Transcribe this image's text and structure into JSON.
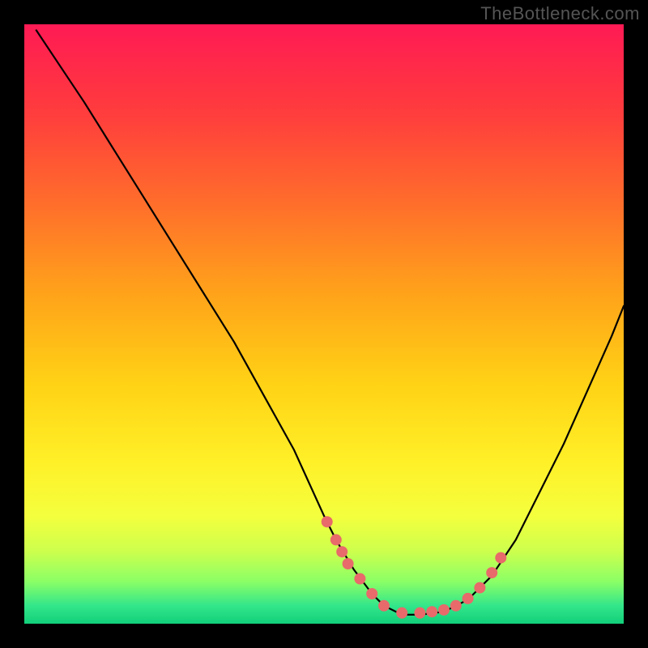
{
  "watermark": "TheBottleneck.com",
  "chart_data": {
    "type": "line",
    "title": "",
    "xlabel": "",
    "ylabel": "",
    "xlim": [
      0,
      100
    ],
    "ylim": [
      0,
      100
    ],
    "grid": false,
    "legend": false,
    "series": [
      {
        "name": "curve",
        "x": [
          2,
          6,
          10,
          15,
          20,
          25,
          30,
          35,
          40,
          45,
          50,
          52,
          55,
          58,
          60,
          63,
          66,
          70,
          74,
          78,
          82,
          86,
          90,
          94,
          98,
          100
        ],
        "y": [
          99,
          93,
          87,
          79,
          71,
          63,
          55,
          47,
          38,
          29,
          18,
          14,
          9,
          5,
          3,
          1.5,
          1.5,
          2,
          4,
          8,
          14,
          22,
          30,
          39,
          48,
          53
        ]
      }
    ],
    "markers": {
      "name": "dots",
      "x": [
        50.5,
        52,
        53,
        54,
        56,
        58,
        60,
        63,
        66,
        68,
        70,
        72,
        74,
        76,
        78,
        79.5
      ],
      "y": [
        17,
        14,
        12,
        10,
        7.5,
        5,
        3,
        1.8,
        1.8,
        2,
        2.3,
        3,
        4.2,
        6,
        8.5,
        11
      ]
    },
    "background_gradient": {
      "stops": [
        {
          "pos": 0.0,
          "color": "#ff1a54"
        },
        {
          "pos": 0.15,
          "color": "#ff3d3d"
        },
        {
          "pos": 0.3,
          "color": "#ff6e2b"
        },
        {
          "pos": 0.45,
          "color": "#ffa31a"
        },
        {
          "pos": 0.6,
          "color": "#ffd215"
        },
        {
          "pos": 0.73,
          "color": "#fff028"
        },
        {
          "pos": 0.82,
          "color": "#f4ff3d"
        },
        {
          "pos": 0.88,
          "color": "#ccff4d"
        },
        {
          "pos": 0.93,
          "color": "#8aff66"
        },
        {
          "pos": 0.97,
          "color": "#33e68a"
        },
        {
          "pos": 1.0,
          "color": "#12cf7a"
        }
      ]
    }
  }
}
